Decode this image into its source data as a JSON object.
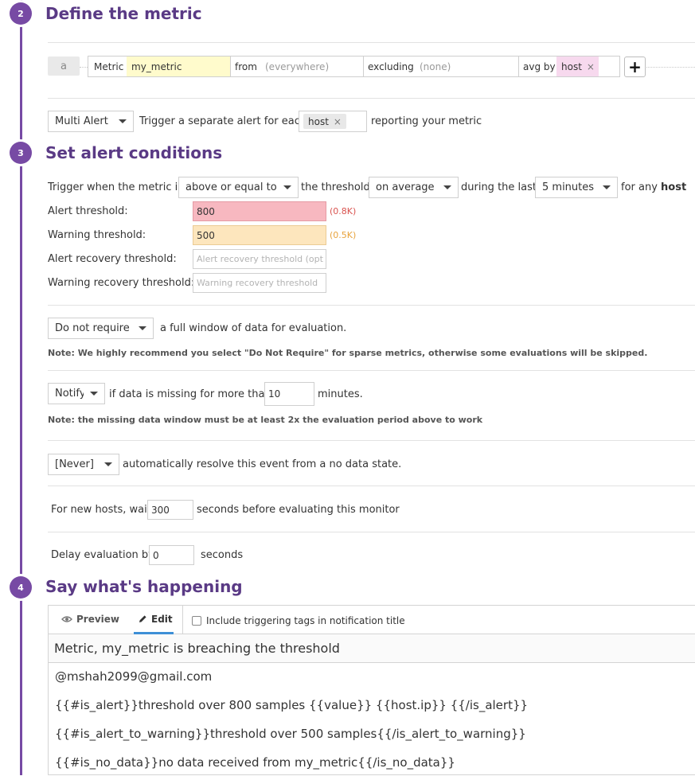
{
  "steps": {
    "define": {
      "number": "2",
      "title": "Define the metric"
    },
    "conditions": {
      "number": "3",
      "title": "Set alert conditions"
    },
    "say": {
      "number": "4",
      "title": "Say what's happening"
    }
  },
  "metric_query": {
    "query_label": "a",
    "metric_label": "Metric",
    "metric_value": "my_metric",
    "from_label": "from",
    "from_placeholder": "(everywhere)",
    "excluding_label": "excluding",
    "excluding_placeholder": "(none)",
    "avg_by_label": "avg by",
    "avg_by_tag": "host",
    "remove_glyph": "×",
    "add_button": "+"
  },
  "alert_type": {
    "selected": "Multi Alert",
    "text_before": "Trigger a separate alert for each",
    "group_tag": "host",
    "text_after": "reporting your metric"
  },
  "conditions": {
    "trigger_prefix": "Trigger when the metric is",
    "comparator": "above or equal to",
    "threshold_text": "the threshold",
    "aggregation": "on average",
    "during_text": "during the last",
    "timeframe": "5 minutes",
    "for_any_text": "for any",
    "for_any_group": "host",
    "alert_threshold_label": "Alert threshold:",
    "alert_threshold_value": "800",
    "alert_threshold_hint": "(0.8K)",
    "warning_threshold_label": "Warning threshold:",
    "warning_threshold_value": "500",
    "warning_threshold_hint": "(0.5K)",
    "alert_recovery_label": "Alert recovery threshold:",
    "alert_recovery_placeholder": "Alert recovery threshold (opt",
    "warning_recovery_label": "Warning recovery threshold:",
    "warning_recovery_placeholder": "Warning recovery threshold"
  },
  "require_window": {
    "selected": "Do not require",
    "text": "a full window of data for evaluation.",
    "note": "Note: We highly recommend you select \"Do Not Require\" for sparse metrics, otherwise some evaluations will be skipped."
  },
  "missing_data": {
    "selected": "Notify",
    "text_before": "if data is missing for more than",
    "value": "10",
    "text_after": "minutes.",
    "note": "Note: the missing data window must be at least 2x the evaluation period above to work"
  },
  "auto_resolve": {
    "selected": "[Never]",
    "text": "automatically resolve this event from a no data state."
  },
  "new_host": {
    "text_before": "For new hosts, wait",
    "value": "300",
    "text_after": "seconds before evaluating this monitor"
  },
  "delay": {
    "text_before": "Delay evaluation by",
    "value": "0",
    "text_after": "seconds"
  },
  "editor": {
    "preview_tab": "Preview",
    "edit_tab": "Edit",
    "include_tags_label": "Include triggering tags in notification title",
    "subject": "Metric, my_metric is breaching the threshold",
    "body_lines": [
      "@mshah2099@gmail.com",
      "{{#is_alert}}threshold over 800 samples {{value}} {{host.ip}} {{/is_alert}}",
      "{{#is_alert_to_warning}}threshold over 500 samples{{/is_alert_to_warning}}",
      "{{#is_no_data}}no data received from my_metric{{/is_no_data}}"
    ]
  },
  "colors": {
    "accent": "#774aa4",
    "title": "#5a3a85",
    "alert_fill": "#f7b8c0",
    "alert_hint": "#d9534f",
    "warning_fill": "#fde6bd",
    "warning_hint": "#e8a33d",
    "metric_fill": "#fffbcc",
    "tag_fill": "#f7d9ee",
    "tab_active": "#3d8fd6"
  }
}
